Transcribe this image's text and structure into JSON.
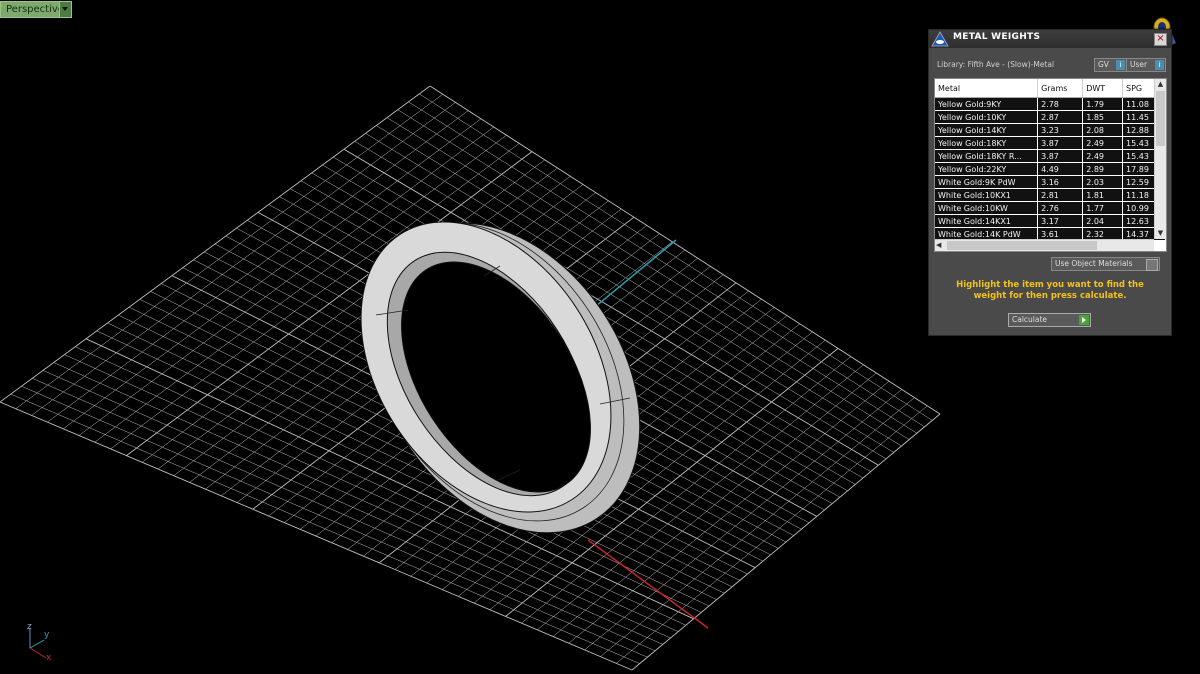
{
  "viewport": {
    "label": "Perspective"
  },
  "panel": {
    "title": "METAL WEIGHTS",
    "library_label": "Library: Fifth Ave - (Slow)-Metal",
    "gv_label": "GV",
    "user_label": "User",
    "info_glyph": "i",
    "close_glyph": "×",
    "columns": [
      "Metal",
      "Grams",
      "DWT",
      "SPG"
    ],
    "rows": [
      {
        "metal": "Yellow Gold:9KY",
        "grams": "2.78",
        "dwt": "1.79",
        "spg": "11.08"
      },
      {
        "metal": "Yellow Gold:10KY",
        "grams": "2.87",
        "dwt": "1.85",
        "spg": "11.45"
      },
      {
        "metal": "Yellow Gold:14KY",
        "grams": "3.23",
        "dwt": "2.08",
        "spg": "12.88"
      },
      {
        "metal": "Yellow Gold:18KY",
        "grams": "3.87",
        "dwt": "2.49",
        "spg": "15.43"
      },
      {
        "metal": "Yellow Gold:18KY R...",
        "grams": "3.87",
        "dwt": "2.49",
        "spg": "15.43"
      },
      {
        "metal": "Yellow Gold:22KY",
        "grams": "4.49",
        "dwt": "2.89",
        "spg": "17.89"
      },
      {
        "metal": "White Gold:9K PdW",
        "grams": "3.16",
        "dwt": "2.03",
        "spg": "12.59"
      },
      {
        "metal": "White Gold:10KX1",
        "grams": "2.81",
        "dwt": "1.81",
        "spg": "11.18"
      },
      {
        "metal": "White Gold:10KW",
        "grams": "2.76",
        "dwt": "1.77",
        "spg": "10.99"
      },
      {
        "metal": "White Gold:14KX1",
        "grams": "3.17",
        "dwt": "2.04",
        "spg": "12.63"
      },
      {
        "metal": "White Gold:14K PdW",
        "grams": "3.61",
        "dwt": "2.32",
        "spg": "14.37"
      }
    ],
    "use_object_materials_label": "Use Object Materials",
    "hint_text": "Highlight the item you want to find the weight for then press calculate.",
    "calculate_label": "Calculate"
  },
  "gizmo": {
    "z": "z",
    "y": "y",
    "x": "x"
  },
  "colors": {
    "grid": "#bfbfbf",
    "axis_x": "#c8242a",
    "axis_y": "#2aa2b2",
    "hint": "#f2c21a",
    "perspective_tab": "#7fa86f"
  }
}
